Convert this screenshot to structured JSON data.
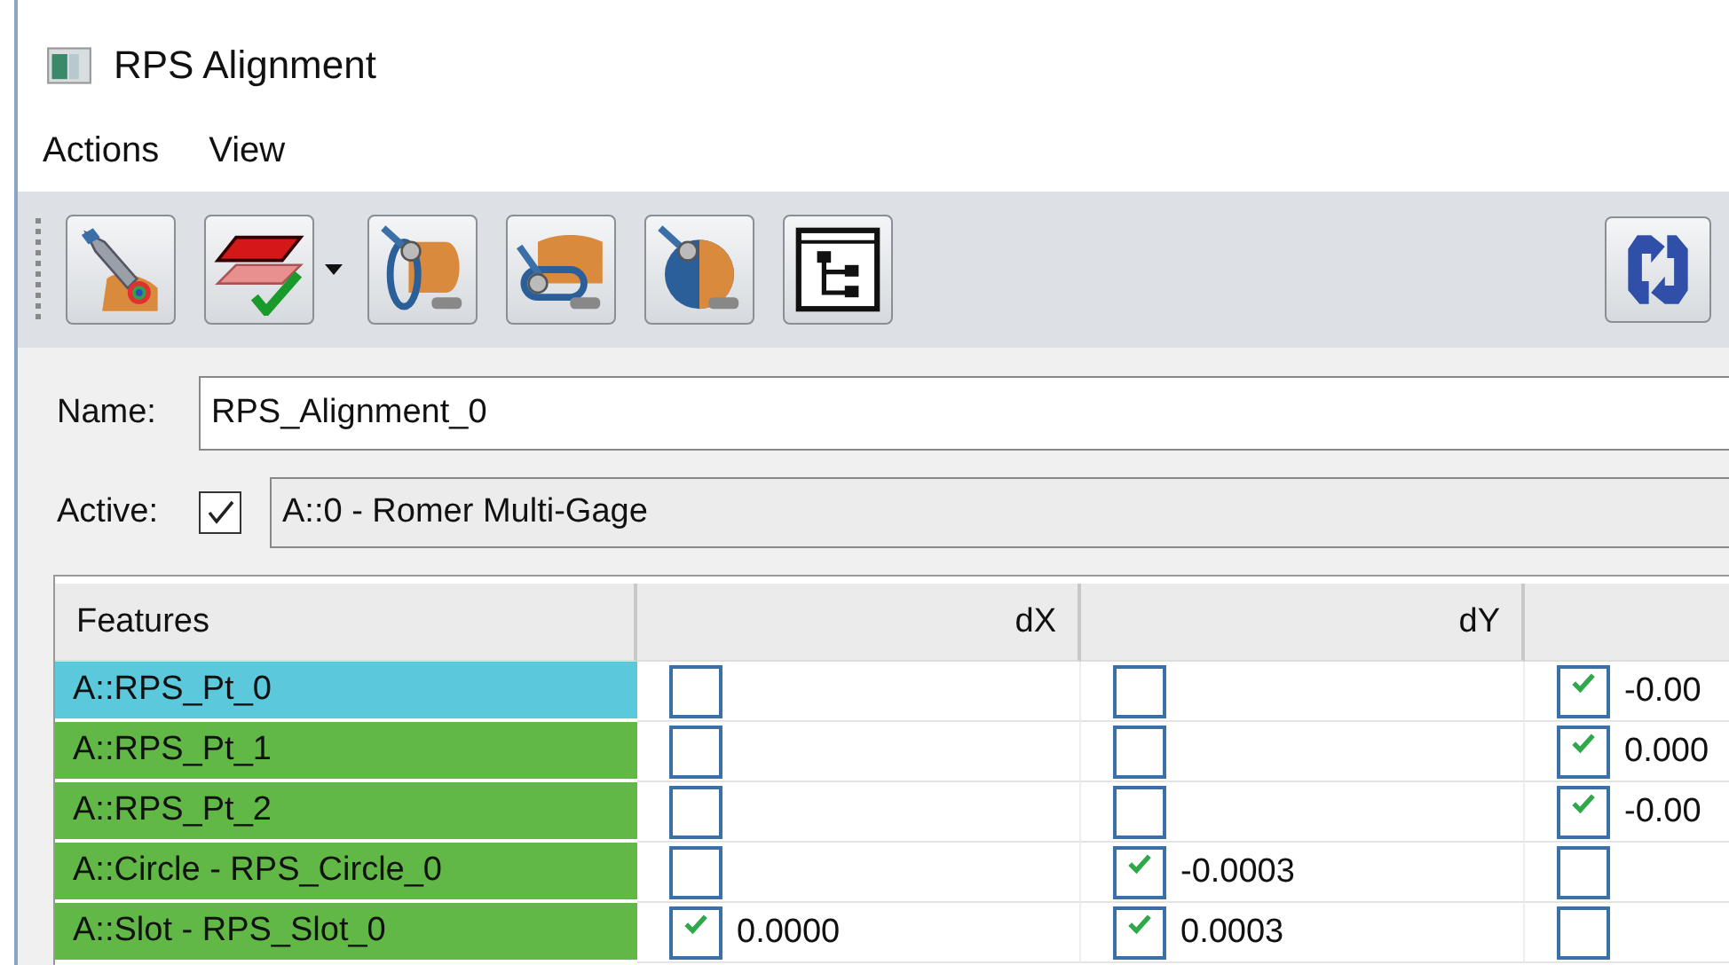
{
  "window": {
    "title": "RPS Alignment"
  },
  "menu": [
    "Actions",
    "View"
  ],
  "toolbar": {
    "buttons": [
      {
        "kind": "probe"
      },
      {
        "kind": "planes",
        "dropdown": true
      },
      {
        "kind": "cylinder"
      },
      {
        "kind": "slot"
      },
      {
        "kind": "sphere"
      },
      {
        "kind": "tree"
      }
    ],
    "refresh": true
  },
  "name_field": {
    "label": "Name:",
    "value": "RPS_Alignment_0"
  },
  "active": {
    "label": "Active:",
    "checked": true,
    "value": "A::0 - Romer Multi-Gage"
  },
  "table": {
    "columns": [
      "Features",
      "dX",
      "dY"
    ],
    "rows": [
      {
        "name": "A::RPS_Pt_0",
        "color": "#5bc8dc",
        "cells": [
          {
            "checked": false
          },
          {
            "checked": false
          },
          {
            "checked": true,
            "value": "-0.00"
          }
        ]
      },
      {
        "name": "A::RPS_Pt_1",
        "color": "#62b846",
        "cells": [
          {
            "checked": false
          },
          {
            "checked": false
          },
          {
            "checked": true,
            "value": "0.000"
          }
        ]
      },
      {
        "name": "A::RPS_Pt_2",
        "color": "#62b846",
        "cells": [
          {
            "checked": false
          },
          {
            "checked": false
          },
          {
            "checked": true,
            "value": "-0.00"
          }
        ]
      },
      {
        "name": "A::Circle - RPS_Circle_0",
        "color": "#62b846",
        "cells": [
          {
            "checked": false
          },
          {
            "checked": true,
            "value": "-0.0003"
          },
          {
            "checked": false
          }
        ]
      },
      {
        "name": "A::Slot - RPS_Slot_0",
        "color": "#62b846",
        "cells": [
          {
            "checked": true,
            "value": "0.0000"
          },
          {
            "checked": true,
            "value": "0.0003"
          },
          {
            "checked": false
          }
        ]
      }
    ]
  }
}
